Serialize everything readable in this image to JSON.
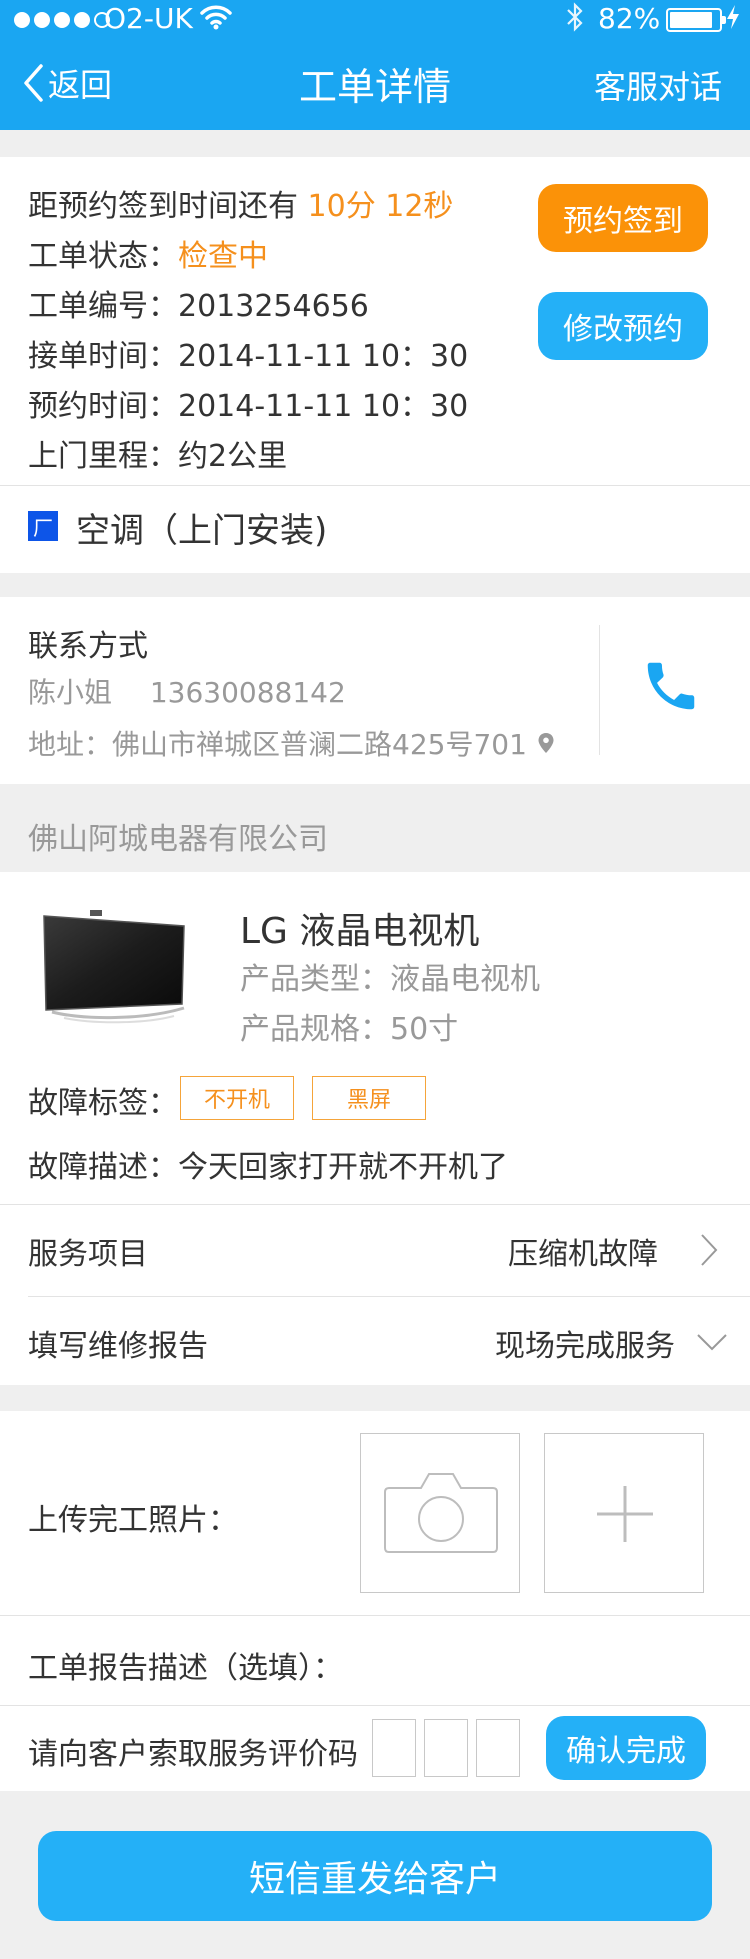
{
  "status_bar": {
    "carrier": "O2-UK",
    "battery": "82%"
  },
  "nav": {
    "back_label": "返回",
    "title": "工单详情",
    "right_label": "客服对话"
  },
  "order": {
    "countdown_prefix": "距预约签到时间还有",
    "countdown_value": "10分 12秒",
    "status_label": "工单状态：",
    "status_value": "检查中",
    "number_line": "工单编号：2013254656",
    "accept_time_line": "接单时间：2014-11-11  10：30",
    "appoint_time_line": "预约时间：2014-11-11  10：30",
    "distance_line": "上门里程：约2公里",
    "checkin_button": "预约签到",
    "modify_button": "修改预约",
    "factory_badge": "厂",
    "service_type": "空调（上门安装)"
  },
  "contact": {
    "title": "联系方式",
    "name": "陈小姐",
    "phone": "13630088142",
    "address": "地址：佛山市禅城区普澜二路425号701"
  },
  "company": {
    "name": "佛山阿城电器有限公司"
  },
  "product": {
    "title": "LG   液晶电视机",
    "type_line": "产品类型：液晶电视机",
    "spec_line": "产品规格：50寸",
    "fault_tags_label": "故障标签：",
    "fault_tags": [
      "不开机",
      "黑屏"
    ],
    "fault_desc": "故障描述：今天回家打开就不开机了"
  },
  "service_item": {
    "label": "服务项目",
    "value": "压缩机故障"
  },
  "repair_report": {
    "label": "填写维修报告",
    "value": "现场完成服务"
  },
  "completion": {
    "upload_label": "上传完工照片：",
    "report_desc_label": "工单报告描述（选填）：",
    "eval_code_label": "请向客户索取服务评价码",
    "confirm_button": "确认完成"
  },
  "resend_button": "短信重发给客户",
  "colors": {
    "primary_blue": "#1aa6f2",
    "button_blue": "#24b0f7",
    "accent_orange": "#fb9208",
    "factory_badge_blue": "#0d55e8"
  }
}
